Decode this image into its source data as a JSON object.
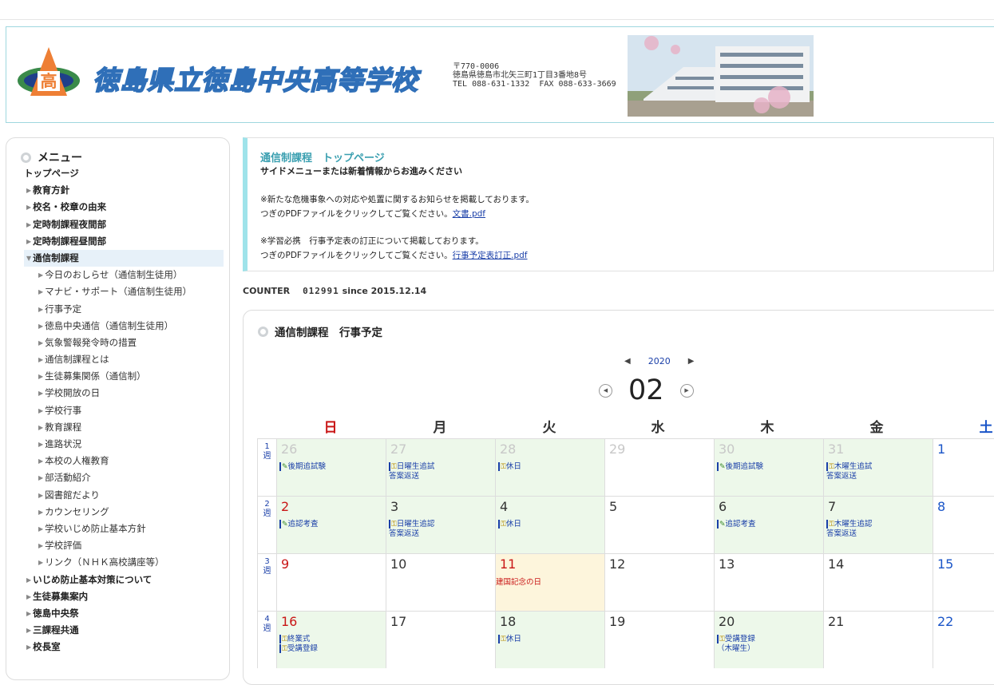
{
  "header": {
    "logo_char": "高",
    "school_name": "徳島県立徳島中央高等学校",
    "address_lines": [
      "〒770-0006",
      "徳島県徳島市北矢三町1丁目3番地8号",
      "TEL 088-631-1332  FAX 088-633-3669"
    ]
  },
  "sidebar": {
    "title": "メニュー",
    "items": [
      {
        "label": "トップページ",
        "level": "top"
      },
      {
        "label": "教育方針",
        "level": "l1"
      },
      {
        "label": "校名・校章の由来",
        "level": "l1"
      },
      {
        "label": "定時制課程夜間部",
        "level": "l1"
      },
      {
        "label": "定時制課程昼間部",
        "level": "l1"
      },
      {
        "label": "通信制課程",
        "level": "l1",
        "open": true
      },
      {
        "label": "今日のおしらせ（通信制生徒用）",
        "level": "l2"
      },
      {
        "label": "マナビ・サポート（通信制生徒用）",
        "level": "l2"
      },
      {
        "label": "行事予定",
        "level": "l2"
      },
      {
        "label": "徳島中央通信（通信制生徒用）",
        "level": "l2"
      },
      {
        "label": "気象警報発令時の措置",
        "level": "l2"
      },
      {
        "label": "通信制課程とは",
        "level": "l2"
      },
      {
        "label": "生徒募集関係（通信制）",
        "level": "l2"
      },
      {
        "label": "学校開放の日",
        "level": "l2"
      },
      {
        "label": "学校行事",
        "level": "l2"
      },
      {
        "label": "教育課程",
        "level": "l2"
      },
      {
        "label": "進路状況",
        "level": "l2"
      },
      {
        "label": "本校の人権教育",
        "level": "l2"
      },
      {
        "label": "部活動紹介",
        "level": "l2"
      },
      {
        "label": "図書館だより",
        "level": "l2"
      },
      {
        "label": "カウンセリング",
        "level": "l2"
      },
      {
        "label": "学校いじめ防止基本方針",
        "level": "l2"
      },
      {
        "label": "学校評価",
        "level": "l2"
      },
      {
        "label": "リンク（ＮＨＫ高校講座等）",
        "level": "l2"
      },
      {
        "label": "いじめ防止基本対策について",
        "level": "l1"
      },
      {
        "label": "生徒募集案内",
        "level": "l1"
      },
      {
        "label": "徳島中央祭",
        "level": "l1"
      },
      {
        "label": "三課程共通",
        "level": "l1"
      },
      {
        "label": "校長室",
        "level": "l1"
      }
    ]
  },
  "notice": {
    "title": "通信制課程　トップページ",
    "subtitle": "サイドメニューまたは新着情報からお進みください",
    "para1_line1": "※新たな危機事象への対応や処置に関するお知らせを掲載しております。",
    "para1_line2": "つぎのPDFファイルをクリックしてご覧ください。",
    "link1": "文書.pdf",
    "para2_line1": "※学習必携　行事予定表の訂正について掲載しております。",
    "para2_line2": "つぎのPDFファイルをクリックしてご覧ください。",
    "link2": "行事予定表訂正.pdf"
  },
  "counter": {
    "label": "COUNTER",
    "value": "012991",
    "since": "since 2015.12.14"
  },
  "calendar": {
    "title": "通信制課程　行事予定",
    "year": "2020",
    "month": "02",
    "weekdays": [
      "日",
      "月",
      "火",
      "水",
      "木",
      "金",
      "土"
    ],
    "weekday_colors": [
      "#c91616",
      "#333333",
      "#333333",
      "#333333",
      "#333333",
      "#333333",
      "#1a55c8"
    ],
    "weeks": [
      {
        "label": "1週",
        "days": [
          {
            "d": "26",
            "other": true,
            "bg": "ev",
            "events": [
              {
                "icon": "pencil",
                "text": "後期追試験"
              }
            ]
          },
          {
            "d": "27",
            "other": true,
            "bg": "ev",
            "events": [
              {
                "icon": "key",
                "text": "日曜生追試"
              },
              {
                "text": "答案返送"
              }
            ]
          },
          {
            "d": "28",
            "other": true,
            "bg": "ev",
            "events": [
              {
                "icon": "key",
                "text": "休日"
              }
            ]
          },
          {
            "d": "29",
            "other": true,
            "bg": "",
            "events": []
          },
          {
            "d": "30",
            "other": true,
            "bg": "ev",
            "events": [
              {
                "icon": "pencil",
                "text": "後期追試験"
              }
            ]
          },
          {
            "d": "31",
            "other": true,
            "bg": "ev",
            "events": [
              {
                "icon": "key",
                "text": "木曜生追試"
              },
              {
                "text": "答案返送"
              }
            ]
          },
          {
            "d": "1",
            "bg": "",
            "events": []
          }
        ]
      },
      {
        "label": "2週",
        "days": [
          {
            "d": "2",
            "bg": "ev",
            "events": [
              {
                "icon": "pencil",
                "text": "追認考査"
              }
            ]
          },
          {
            "d": "3",
            "bg": "ev",
            "events": [
              {
                "icon": "key",
                "text": "日曜生追認"
              },
              {
                "text": "答案返送"
              }
            ]
          },
          {
            "d": "4",
            "bg": "ev",
            "events": [
              {
                "icon": "key",
                "text": "休日"
              }
            ]
          },
          {
            "d": "5",
            "bg": "",
            "events": []
          },
          {
            "d": "6",
            "bg": "ev",
            "events": [
              {
                "icon": "pencil",
                "text": "追認考査"
              }
            ]
          },
          {
            "d": "7",
            "bg": "ev",
            "events": [
              {
                "icon": "key",
                "text": "木曜生追認"
              },
              {
                "text": "答案返送"
              }
            ]
          },
          {
            "d": "8",
            "bg": "",
            "events": []
          }
        ]
      },
      {
        "label": "3週",
        "days": [
          {
            "d": "9",
            "bg": "",
            "events": []
          },
          {
            "d": "10",
            "bg": "",
            "events": []
          },
          {
            "d": "11",
            "bg": "hol",
            "holiday": "建国記念の日",
            "events": []
          },
          {
            "d": "12",
            "bg": "",
            "events": []
          },
          {
            "d": "13",
            "bg": "",
            "events": []
          },
          {
            "d": "14",
            "bg": "",
            "events": []
          },
          {
            "d": "15",
            "bg": "",
            "events": []
          }
        ]
      },
      {
        "label": "4週",
        "days": [
          {
            "d": "16",
            "bg": "ev",
            "events": [
              {
                "icon": "key",
                "text": "終業式"
              },
              {
                "icon": "key",
                "text": "受講登録"
              }
            ]
          },
          {
            "d": "17",
            "bg": "",
            "events": []
          },
          {
            "d": "18",
            "bg": "ev",
            "events": [
              {
                "icon": "key",
                "text": "休日"
              }
            ]
          },
          {
            "d": "19",
            "bg": "",
            "events": []
          },
          {
            "d": "20",
            "bg": "ev",
            "events": [
              {
                "icon": "key",
                "text": "受講登録"
              },
              {
                "text": "（木曜生）"
              }
            ]
          },
          {
            "d": "21",
            "bg": "",
            "events": []
          },
          {
            "d": "22",
            "bg": "",
            "events": []
          }
        ]
      }
    ]
  }
}
